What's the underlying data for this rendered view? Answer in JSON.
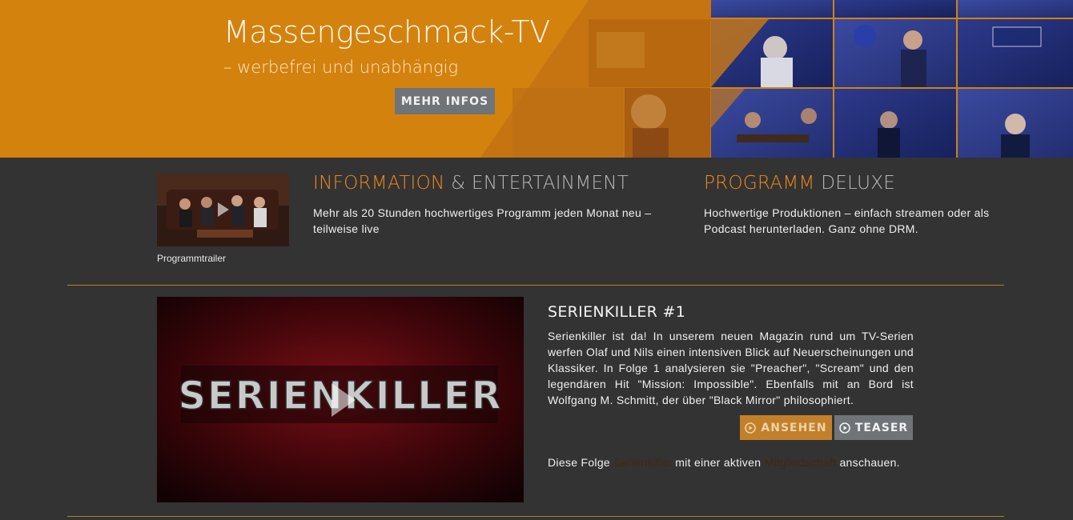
{
  "hero": {
    "title": "Massengeschmack-TV",
    "subtitle": "– werbefrei und unabhängig",
    "button_label": "MEHR INFOS",
    "background_color": "#d4820e"
  },
  "trailer": {
    "caption": "Programmtrailer"
  },
  "features": [
    {
      "title_accent": "INFORMATION",
      "title_rest": " & ENTERTAINMENT",
      "text": "Mehr als 20 Stunden hochwertiges Programm jeden Monat neu – teilweise live"
    },
    {
      "title_accent": "PROGRAMM",
      "title_rest": " DELUXE",
      "text": "Hochwertige Produktionen – einfach streamen oder als Podcast herunterladen. Ganz ohne DRM."
    }
  ],
  "episode": {
    "video_logo_text": "SERIENKILLER",
    "title": "SERIENKILLER #1",
    "description": "Serienkiller ist da! In unserem neuen Magazin rund um TV-Serien werfen Olaf und Nils einen intensiven Blick auf Neuerscheinungen und Klassiker. In Folge 1 analysieren sie \"Preacher\", \"Scream\" und den legendären Hit \"Mission: Impossible\". Ebenfalls mit an Bord ist Wolfgang M. Schmitt, der über \"Black Mirror\" philosophiert.",
    "watch_label": "ANSEHEN",
    "teaser_label": "TEASER",
    "note_prefix": "Diese Folge ",
    "note_link_show": "Serienkiller",
    "note_middle": " mit einer aktiven ",
    "note_link_membership": "Mitgliedschaft",
    "note_suffix": " anschauen."
  },
  "colors": {
    "accent": "#f0891a",
    "divider": "#b77b2c",
    "background": "#333333"
  }
}
